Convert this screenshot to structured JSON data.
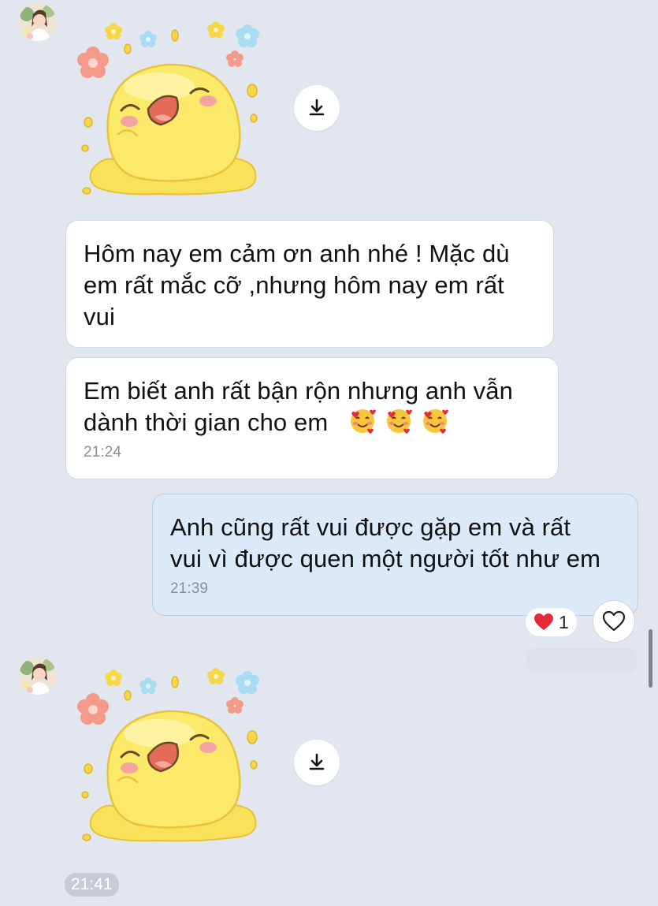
{
  "messages": [
    {
      "id": "m1",
      "text_lines": [
        "Hôm nay em cảm ơn anh nhé ! Mặc dù",
        "em rất mắc cỡ ,nhưng hôm nay em rất",
        "vui"
      ]
    },
    {
      "id": "m2",
      "text_lines": [
        "Em biết anh rất bận rộn nhưng anh vẫn",
        "dành thời gian cho em"
      ],
      "emojis": [
        "smiling-face-with-hearts",
        "smiling-face-with-hearts",
        "smiling-face-with-hearts"
      ],
      "time": "21:24"
    },
    {
      "id": "m3",
      "text_lines": [
        "Anh cũng rất vui được gặp em và rất",
        "vui vì được quen một người tốt như em"
      ],
      "time": "21:39",
      "reaction": {
        "emoji": "red-heart",
        "count": "1"
      }
    }
  ],
  "stickers": [
    {
      "id": "s1",
      "name": "yellow-blob-happy"
    },
    {
      "id": "s2",
      "name": "yellow-blob-happy",
      "time": "21:41"
    }
  ],
  "colors": {
    "background": "#e2e7ef",
    "incoming_bubble": "#ffffff",
    "outgoing_bubble": "#dbe9f8",
    "time_text": "#8a8f96",
    "heart": "#e52a3a"
  }
}
